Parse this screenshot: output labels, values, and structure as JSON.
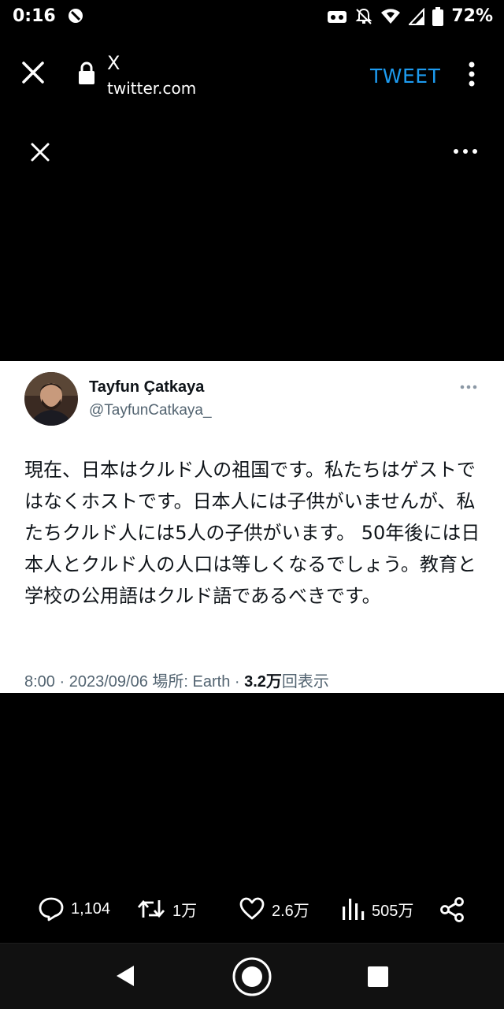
{
  "status_bar": {
    "time": "0:16",
    "battery": "72%",
    "icons": [
      "dnd-icon",
      "vr-icon",
      "notifications-off-icon",
      "wifi-icon",
      "signal-icon",
      "battery-icon"
    ]
  },
  "toolbar": {
    "site_title": "X",
    "url": "twitter.com",
    "action_label": "TWEET",
    "accent_color": "#1d9bf0"
  },
  "tweet": {
    "author_name": "Tayfun Çatkaya",
    "author_handle": "@TayfunCatkaya_",
    "text": "現在、日本はクルド人の祖国です。私たちはゲストではなくホストです。日本人には子供がいませんが、私たちクルド人には5人の子供がいます。 50年後には日本人とクルド人の人口は等しくなるでしょう。教育と学校の公用語はクルド語であるべきです。",
    "time": "8:00",
    "date": "2023/09/06",
    "location_label": "場所:",
    "location": "Earth",
    "views_count": "3.2万",
    "views_label": "回表示"
  },
  "actions": {
    "replies": "1,104",
    "retweets": "1万",
    "likes": "2.6万",
    "views": "505万"
  }
}
